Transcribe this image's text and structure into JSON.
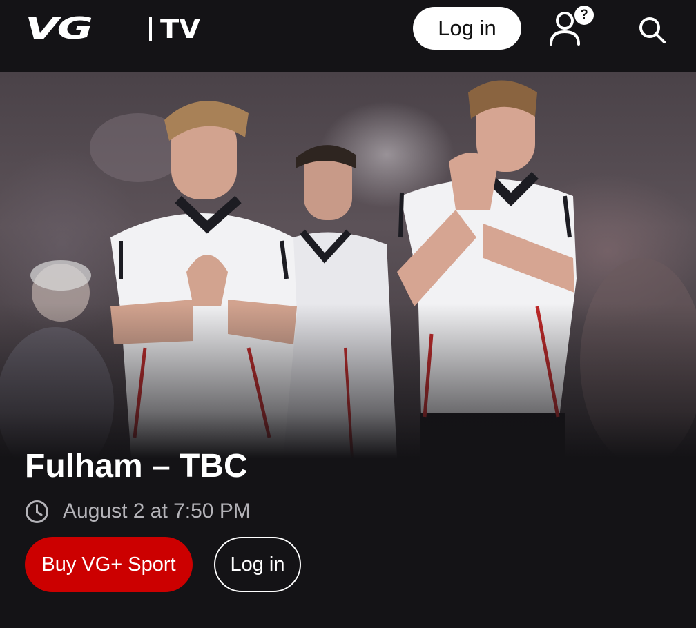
{
  "header": {
    "logo": {
      "brand": "VG",
      "product": "TV"
    },
    "login_label": "Log in",
    "help_badge": "?",
    "icons": {
      "user": "user-icon",
      "search": "search-icon"
    }
  },
  "hero": {
    "image": "photo of Fulham players applauding in white kits"
  },
  "event": {
    "title": "Fulham – TBC",
    "time_icon": "clock-icon",
    "time": "August 2 at 7:50 PM"
  },
  "actions": {
    "buy_label": "Buy VG+ Sport",
    "login_label": "Log in"
  },
  "colors": {
    "background": "#141316",
    "accent": "#cc0000",
    "secondary_text": "#b4b3b8"
  }
}
